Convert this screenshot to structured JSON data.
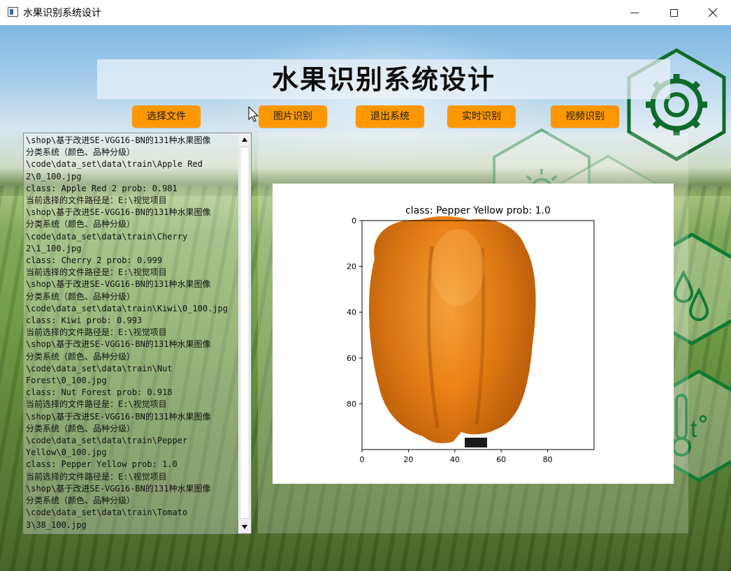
{
  "window": {
    "title": "水果识别系统设计"
  },
  "header": {
    "title": "水果识别系统设计"
  },
  "toolbar": {
    "select_file": "选择文件",
    "image_recognition": "图片识别",
    "exit_system": "退出系统",
    "realtime_recognition": "实时识别",
    "video_recognition": "视频识别"
  },
  "log": {
    "lines": [
      "\\shop\\基于改进SE-VGG16-BN的131种水果图像",
      "分类系统（颜色、品种分级）",
      "\\code\\data_set\\data\\train\\Apple Red",
      "2\\0_100.jpg",
      "class: Apple Red 2   prob: 0.981",
      "当前选择的文件路径是：E:\\视觉项目",
      "\\shop\\基于改进SE-VGG16-BN的131种水果图像",
      "分类系统（颜色、品种分级）",
      "\\code\\data_set\\data\\train\\Cherry",
      "2\\1_100.jpg",
      "class: Cherry 2   prob: 0.999",
      "当前选择的文件路径是：E:\\视觉项目",
      "\\shop\\基于改进SE-VGG16-BN的131种水果图像",
      "分类系统（颜色、品种分级）",
      "\\code\\data_set\\data\\train\\Kiwi\\0_100.jpg",
      "class: Kiwi   prob: 0.993",
      "当前选择的文件路径是：E:\\视觉项目",
      "\\shop\\基于改进SE-VGG16-BN的131种水果图像",
      "分类系统（颜色、品种分级）",
      "\\code\\data_set\\data\\train\\Nut",
      "Forest\\0_100.jpg",
      "class: Nut Forest   prob: 0.918",
      "当前选择的文件路径是：E:\\视觉项目",
      "\\shop\\基于改进SE-VGG16-BN的131种水果图像",
      "分类系统（颜色、品种分级）",
      "\\code\\data_set\\data\\train\\Pepper",
      "Yellow\\0_100.jpg",
      "class: Pepper Yellow   prob: 1.0",
      "当前选择的文件路径是：E:\\视觉项目",
      "\\shop\\基于改进SE-VGG16-BN的131种水果图像",
      "分类系统（颜色、品种分级）",
      "\\code\\data_set\\data\\train\\Tomato",
      "3\\38_100.jpg"
    ]
  },
  "plot": {
    "title": "class: Pepper Yellow   prob: 1.0",
    "x_ticks": [
      "0",
      "20",
      "40",
      "60",
      "80"
    ],
    "y_ticks": [
      "0",
      "20",
      "40",
      "60",
      "80"
    ],
    "x_tick_values": [
      0,
      20,
      40,
      60,
      80
    ],
    "y_tick_values": [
      0,
      20,
      40,
      60,
      80
    ],
    "image_range": [
      0,
      100
    ]
  },
  "icons": {
    "gear": "gear-icon",
    "sun": "sun-icon",
    "water_drops": "water-drops-icon",
    "thermometer": "thermometer-icon"
  },
  "colors": {
    "button": "#ff9800",
    "hex_outline": "#1f8a3a",
    "pepper": "#f08a1c"
  }
}
